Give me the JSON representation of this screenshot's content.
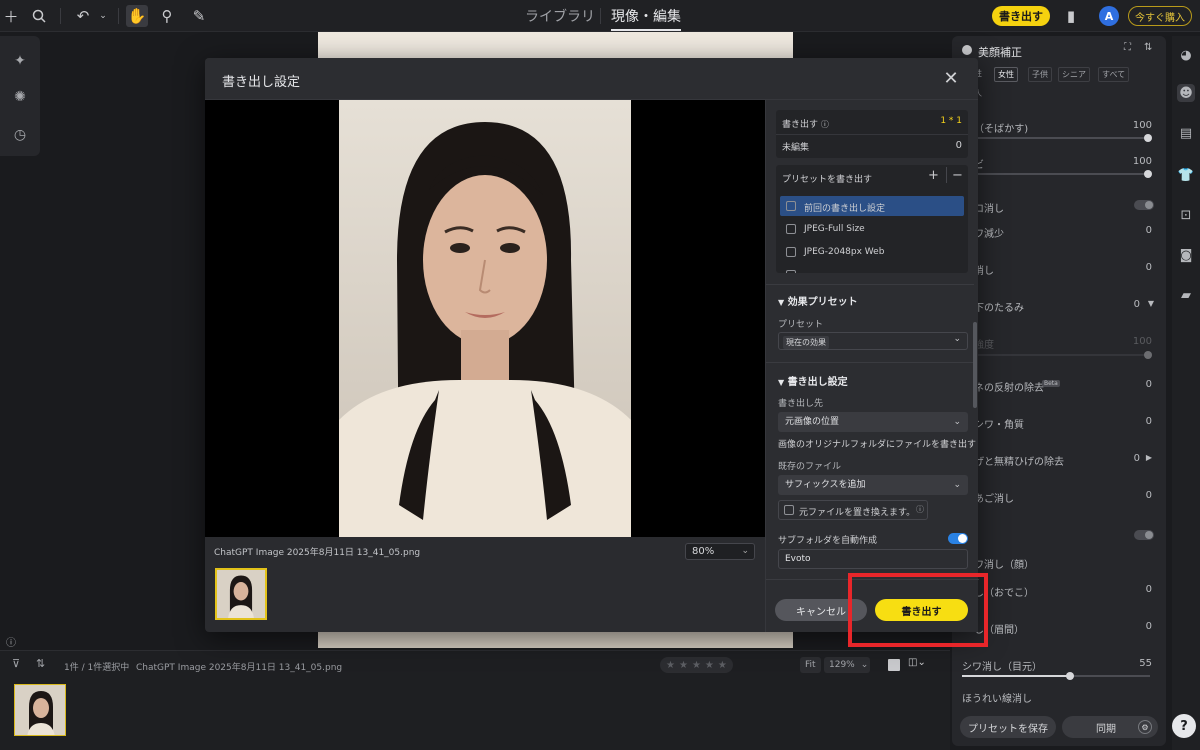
{
  "topbar": {
    "nav_library": "ライブラリ",
    "nav_develop": "現像・編集",
    "export_label": "書き出す",
    "avatar_letter": "A",
    "buy_label": "今すぐ購入"
  },
  "right_panel": {
    "title": "美顔補正",
    "filter_tabs": [
      "性",
      "女性",
      "子供",
      "シニア",
      "すべて",
      "人"
    ],
    "rows": [
      {
        "label": "（そばかす)",
        "value": "100"
      },
      {
        "label": "ビ",
        "value": "100"
      },
      {
        "label": "ロ消し",
        "value": ""
      },
      {
        "label": "ワ減少",
        "value": "0"
      },
      {
        "label": "消し",
        "value": "0"
      },
      {
        "label": "下のたるみ",
        "value": "0"
      },
      {
        "label": "強度",
        "value": "100"
      },
      {
        "label": "ネの反射の除去",
        "value": "0"
      },
      {
        "label": "シワ・角質",
        "value": "0"
      },
      {
        "label": "げと無精ひげの除去",
        "value": "0"
      },
      {
        "label": "あご消し",
        "value": "0"
      },
      {
        "label": "",
        "value": ""
      },
      {
        "label": "ワ消し（顔）",
        "value": ""
      },
      {
        "label": "し（おでこ）",
        "value": "0"
      },
      {
        "label": "し（眉間）",
        "value": "0"
      },
      {
        "label": "シワ消し（目元）",
        "value": "55"
      },
      {
        "label": "ほうれい線消し",
        "value": ""
      }
    ],
    "beta_badge": "Beta",
    "save_preset_label": "プリセットを保存",
    "sync_label": "同期"
  },
  "filmstrip": {
    "count_text": "1件 / 1件選択中",
    "filename": "ChatGPT Image 2025年8月11日 13_41_05.png",
    "fit_label": "Fit",
    "zoom_value": "129%"
  },
  "modal": {
    "title": "書き出し設定",
    "filename": "ChatGPT Image 2025年8月11日 13_41_05.png",
    "zoom_value": "80%",
    "export_count_label": "書き出す",
    "export_count_value": "1 * 1",
    "unedited_label": "未編集",
    "unedited_value": "0",
    "preset_header": "プリセットを書き出す",
    "presets": [
      "前回の書き出し設定",
      "JPEG-Full Size",
      "JPEG-2048px Web"
    ],
    "effect_section": "効果プリセット",
    "preset_field_label": "プリセット",
    "preset_value": "現在の効果",
    "export_section": "書き出し設定",
    "dest_label": "書き出し先",
    "dest_value": "元画像の位置",
    "dest_note": "画像のオリジナルフォルダにファイルを書き出す",
    "existing_label": "既存のファイル",
    "existing_value": "サフィックスを追加",
    "overwrite_label": "元ファイルを置き換えます。",
    "subfolder_label": "サブフォルダを自動作成",
    "subfolder_value": "Evoto",
    "cancel_label": "キャンセル",
    "export_label": "書き出す"
  },
  "colors": {
    "accent_yellow": "#f7de12",
    "highlight_red": "#e8262a",
    "toggle_blue": "#2a82e4",
    "selected_preset": "#2b4f86"
  }
}
